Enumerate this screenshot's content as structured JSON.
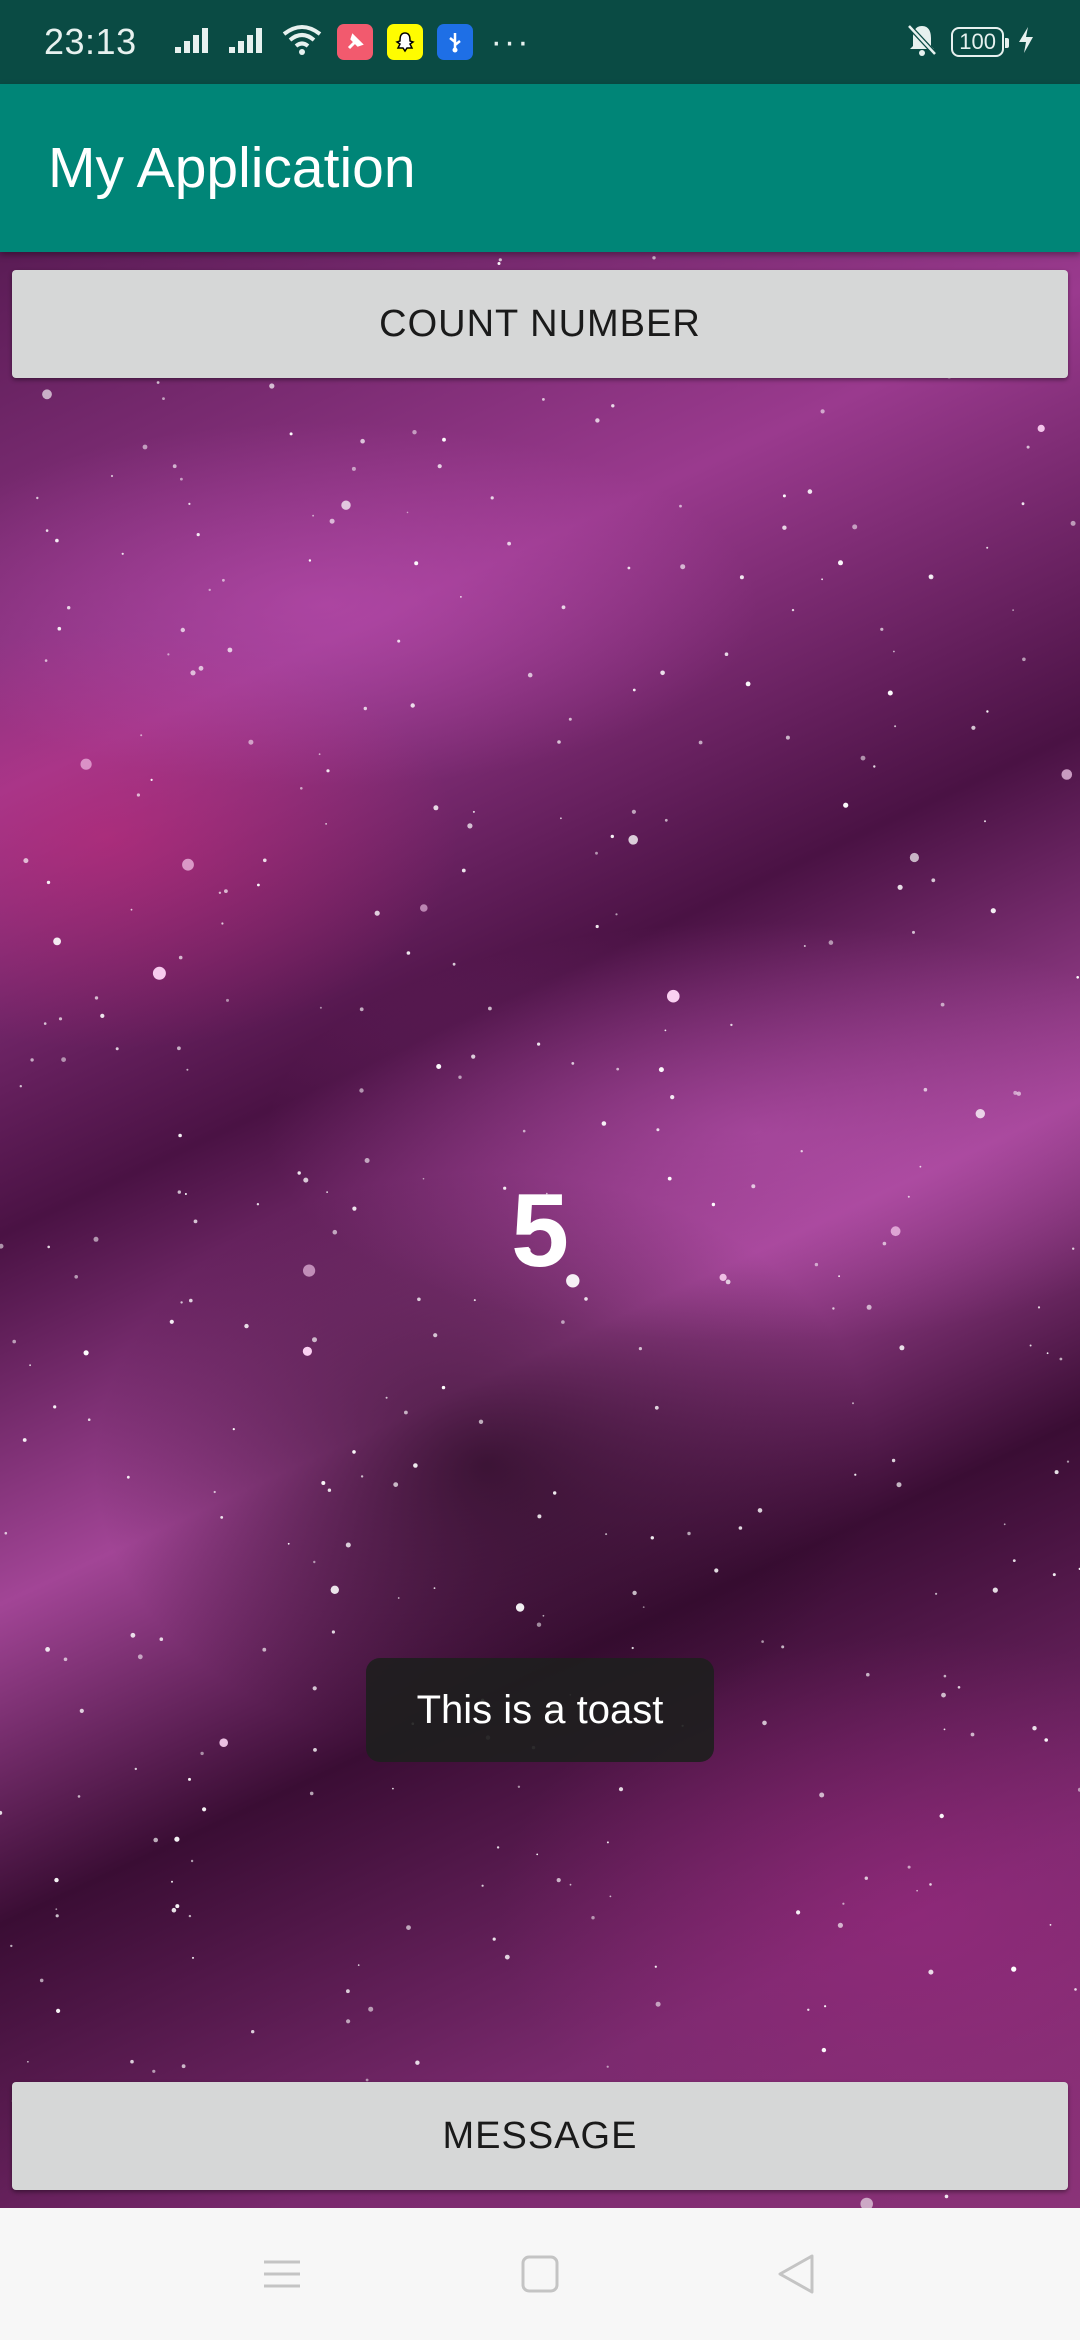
{
  "status_bar": {
    "time": "23:13",
    "battery": "100",
    "more": "···",
    "icons": [
      "signal-icon",
      "signal-icon",
      "wifi-icon",
      "pin-notification-icon",
      "snapchat-icon",
      "usb-icon",
      "notifications-off-icon",
      "battery-icon",
      "charging-icon"
    ]
  },
  "app_bar": {
    "title": "My Application",
    "color": "#008577"
  },
  "main": {
    "count_button_label": "COUNT NUMBER",
    "counter_value": "5",
    "message_button_label": "MESSAGE"
  },
  "toast": {
    "text": "This is a toast"
  },
  "nav_bar": {
    "icons": [
      "menu-icon",
      "home-icon",
      "back-icon"
    ]
  }
}
